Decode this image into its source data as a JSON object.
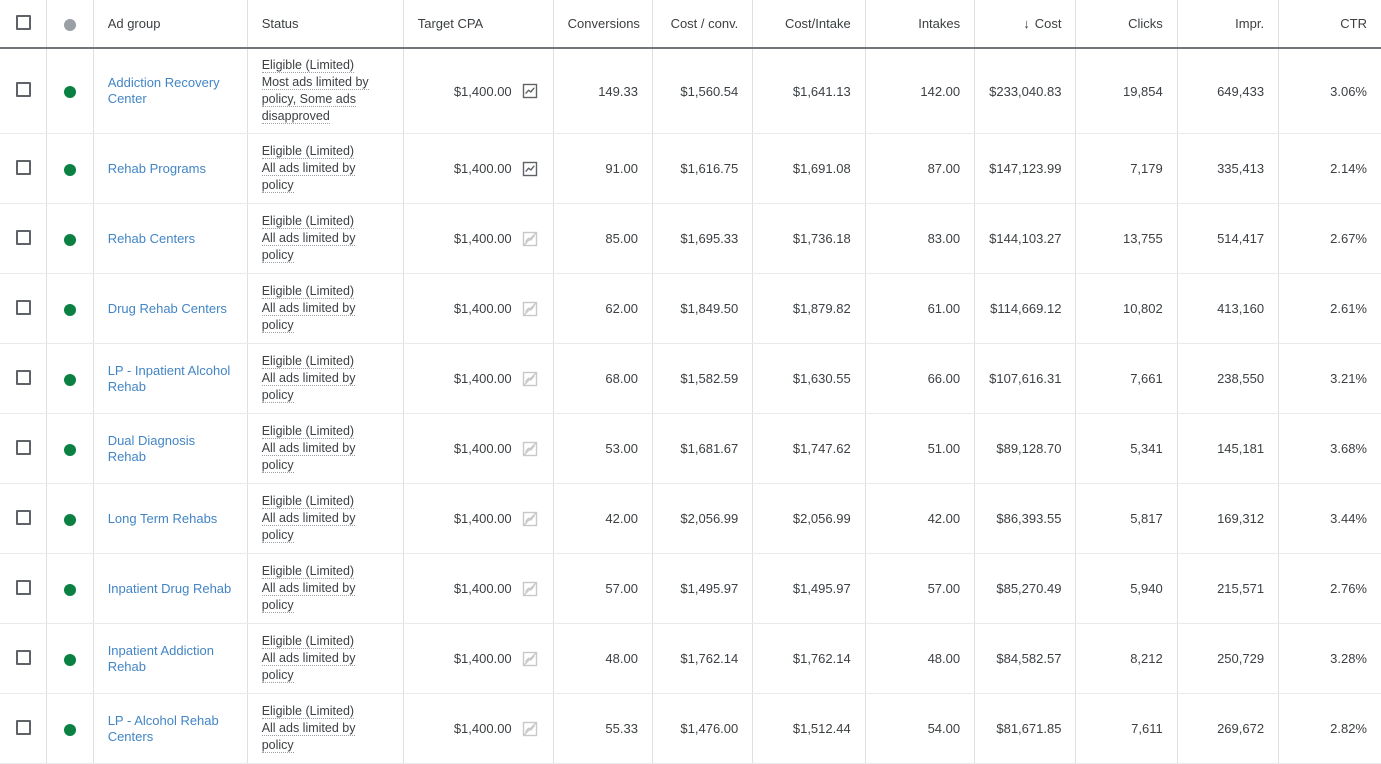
{
  "table": {
    "columns": [
      {
        "key": "checkbox",
        "label": "",
        "align": "center",
        "sorted": false
      },
      {
        "key": "status_dot",
        "label": "",
        "align": "center",
        "sorted": false
      },
      {
        "key": "ad_group",
        "label": "Ad group",
        "align": "left",
        "sorted": false
      },
      {
        "key": "status",
        "label": "Status",
        "align": "left",
        "sorted": false
      },
      {
        "key": "target_cpa",
        "label": "Target CPA",
        "align": "left",
        "sorted": false
      },
      {
        "key": "conversions",
        "label": "Conversions",
        "align": "right",
        "sorted": false
      },
      {
        "key": "cost_conv",
        "label": "Cost / conv.",
        "align": "right",
        "sorted": false
      },
      {
        "key": "cost_intake",
        "label": "Cost/Intake",
        "align": "right",
        "sorted": false
      },
      {
        "key": "intakes",
        "label": "Intakes",
        "align": "right",
        "sorted": false
      },
      {
        "key": "cost",
        "label": "Cost",
        "align": "right",
        "sorted": true
      },
      {
        "key": "clicks",
        "label": "Clicks",
        "align": "right",
        "sorted": false
      },
      {
        "key": "impr",
        "label": "Impr.",
        "align": "right",
        "sorted": false
      },
      {
        "key": "ctr",
        "label": "CTR",
        "align": "right",
        "sorted": false
      }
    ],
    "sort": {
      "column": "Cost",
      "direction": "descending",
      "arrow_glyph": "↓"
    },
    "header_status_dot": "gray",
    "rows": [
      {
        "ad_group": "Addiction Recovery Center",
        "status_dot": "green",
        "status_main": "Eligible (Limited)",
        "status_detail": "Most ads limited by policy, Some ads disapproved",
        "target_cpa": "$1,400.00",
        "target_cpa_icon": "chart-icon",
        "target_cpa_icon_state": "active",
        "conversions": "149.33",
        "cost_conv": "$1,560.54",
        "cost_intake": "$1,641.13",
        "intakes": "142.00",
        "cost": "$233,040.83",
        "clicks": "19,854",
        "impr": "649,433",
        "ctr": "3.06%"
      },
      {
        "ad_group": "Rehab Programs",
        "status_dot": "green",
        "status_main": "Eligible (Limited)",
        "status_detail": "All ads limited by policy",
        "target_cpa": "$1,400.00",
        "target_cpa_icon": "chart-icon",
        "target_cpa_icon_state": "active",
        "conversions": "91.00",
        "cost_conv": "$1,616.75",
        "cost_intake": "$1,691.08",
        "intakes": "87.00",
        "cost": "$147,123.99",
        "clicks": "7,179",
        "impr": "335,413",
        "ctr": "2.14%"
      },
      {
        "ad_group": "Rehab Centers",
        "status_dot": "green",
        "status_main": "Eligible (Limited)",
        "status_detail": "All ads limited by policy",
        "target_cpa": "$1,400.00",
        "target_cpa_icon": "chart-off-icon",
        "target_cpa_icon_state": "disabled",
        "conversions": "85.00",
        "cost_conv": "$1,695.33",
        "cost_intake": "$1,736.18",
        "intakes": "83.00",
        "cost": "$144,103.27",
        "clicks": "13,755",
        "impr": "514,417",
        "ctr": "2.67%"
      },
      {
        "ad_group": "Drug Rehab Centers",
        "status_dot": "green",
        "status_main": "Eligible (Limited)",
        "status_detail": "All ads limited by policy",
        "target_cpa": "$1,400.00",
        "target_cpa_icon": "chart-off-icon",
        "target_cpa_icon_state": "disabled",
        "conversions": "62.00",
        "cost_conv": "$1,849.50",
        "cost_intake": "$1,879.82",
        "intakes": "61.00",
        "cost": "$114,669.12",
        "clicks": "10,802",
        "impr": "413,160",
        "ctr": "2.61%"
      },
      {
        "ad_group": "LP - Inpatient Alcohol Rehab",
        "status_dot": "green",
        "status_main": "Eligible (Limited)",
        "status_detail": "All ads limited by policy",
        "target_cpa": "$1,400.00",
        "target_cpa_icon": "chart-off-icon",
        "target_cpa_icon_state": "disabled",
        "conversions": "68.00",
        "cost_conv": "$1,582.59",
        "cost_intake": "$1,630.55",
        "intakes": "66.00",
        "cost": "$107,616.31",
        "clicks": "7,661",
        "impr": "238,550",
        "ctr": "3.21%"
      },
      {
        "ad_group": "Dual Diagnosis Rehab",
        "status_dot": "green",
        "status_main": "Eligible (Limited)",
        "status_detail": "All ads limited by policy",
        "target_cpa": "$1,400.00",
        "target_cpa_icon": "chart-off-icon",
        "target_cpa_icon_state": "disabled",
        "conversions": "53.00",
        "cost_conv": "$1,681.67",
        "cost_intake": "$1,747.62",
        "intakes": "51.00",
        "cost": "$89,128.70",
        "clicks": "5,341",
        "impr": "145,181",
        "ctr": "3.68%"
      },
      {
        "ad_group": "Long Term Rehabs",
        "status_dot": "green",
        "status_main": "Eligible (Limited)",
        "status_detail": "All ads limited by policy",
        "target_cpa": "$1,400.00",
        "target_cpa_icon": "chart-off-icon",
        "target_cpa_icon_state": "disabled",
        "conversions": "42.00",
        "cost_conv": "$2,056.99",
        "cost_intake": "$2,056.99",
        "intakes": "42.00",
        "cost": "$86,393.55",
        "clicks": "5,817",
        "impr": "169,312",
        "ctr": "3.44%"
      },
      {
        "ad_group": "Inpatient Drug Rehab",
        "status_dot": "green",
        "status_main": "Eligible (Limited)",
        "status_detail": "All ads limited by policy",
        "target_cpa": "$1,400.00",
        "target_cpa_icon": "chart-off-icon",
        "target_cpa_icon_state": "disabled",
        "conversions": "57.00",
        "cost_conv": "$1,495.97",
        "cost_intake": "$1,495.97",
        "intakes": "57.00",
        "cost": "$85,270.49",
        "clicks": "5,940",
        "impr": "215,571",
        "ctr": "2.76%"
      },
      {
        "ad_group": "Inpatient Addiction Rehab",
        "status_dot": "green",
        "status_main": "Eligible (Limited)",
        "status_detail": "All ads limited by policy",
        "target_cpa": "$1,400.00",
        "target_cpa_icon": "chart-off-icon",
        "target_cpa_icon_state": "disabled",
        "conversions": "48.00",
        "cost_conv": "$1,762.14",
        "cost_intake": "$1,762.14",
        "intakes": "48.00",
        "cost": "$84,582.57",
        "clicks": "8,212",
        "impr": "250,729",
        "ctr": "3.28%"
      },
      {
        "ad_group": "LP - Alcohol Rehab Centers",
        "status_dot": "green",
        "status_main": "Eligible (Limited)",
        "status_detail": "All ads limited by policy",
        "target_cpa": "$1,400.00",
        "target_cpa_icon": "chart-off-icon",
        "target_cpa_icon_state": "disabled",
        "conversions": "55.33",
        "cost_conv": "$1,476.00",
        "cost_intake": "$1,512.44",
        "intakes": "54.00",
        "cost": "$81,671.85",
        "clicks": "7,611",
        "impr": "269,672",
        "ctr": "2.82%"
      }
    ]
  },
  "colors": {
    "link": "#4285c5",
    "status_active": "#0b8043",
    "status_header_dot": "#9aa0a6",
    "text": "#3c4043",
    "border": "#e0e0e0",
    "header_rule": "#70757a"
  }
}
